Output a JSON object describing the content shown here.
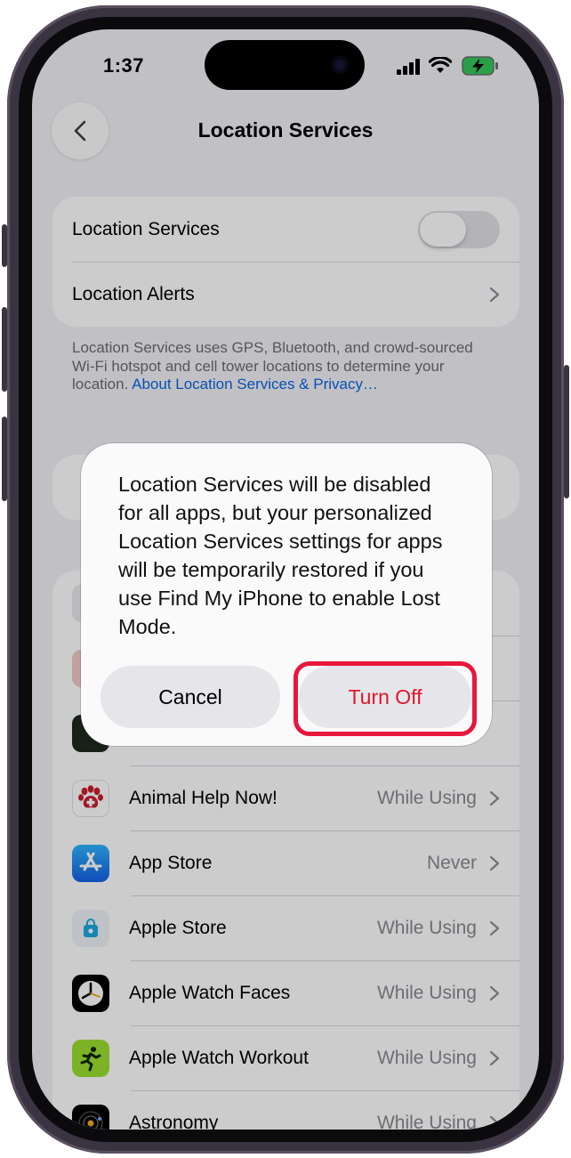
{
  "status_bar": {
    "time": "1:37"
  },
  "nav": {
    "title": "Location Services"
  },
  "settings_group": {
    "location_services_label": "Location Services",
    "location_alerts_label": "Location Alerts"
  },
  "footer": {
    "text": "Location Services uses GPS, Bluetooth, and crowd-sourced Wi-Fi hotspot and cell tower locations to determine your location.",
    "link": "About Location Services & Privacy…"
  },
  "apps": [
    {
      "name": "Animal Help Now!",
      "value": "While Using",
      "icon": "paw-icon",
      "color": "#ffffff"
    },
    {
      "name": "App Store",
      "value": "Never",
      "icon": "app-store-icon",
      "color": "#1a73e8"
    },
    {
      "name": "Apple Store",
      "value": "While Using",
      "icon": "shopping-bag-icon",
      "color": "#eef3f8"
    },
    {
      "name": "Apple Watch Faces",
      "value": "While Using",
      "icon": "watch-face-icon",
      "color": "#000000"
    },
    {
      "name": "Apple Watch Workout",
      "value": "While Using",
      "icon": "runner-icon",
      "color": "#9be030"
    },
    {
      "name": "Astronomy",
      "value": "While Using",
      "icon": "astronomy-icon",
      "color": "#000000"
    }
  ],
  "alert": {
    "message": "Location Services will be disabled for all apps, but your personalized Location Services settings for apps will be temporarily restored if you use Find My iPhone to enable Lost Mode.",
    "cancel_label": "Cancel",
    "turn_off_label": "Turn Off"
  },
  "colors": {
    "destructive": "#e0162b",
    "link": "#0a64e0",
    "highlight": "#e8173c"
  }
}
